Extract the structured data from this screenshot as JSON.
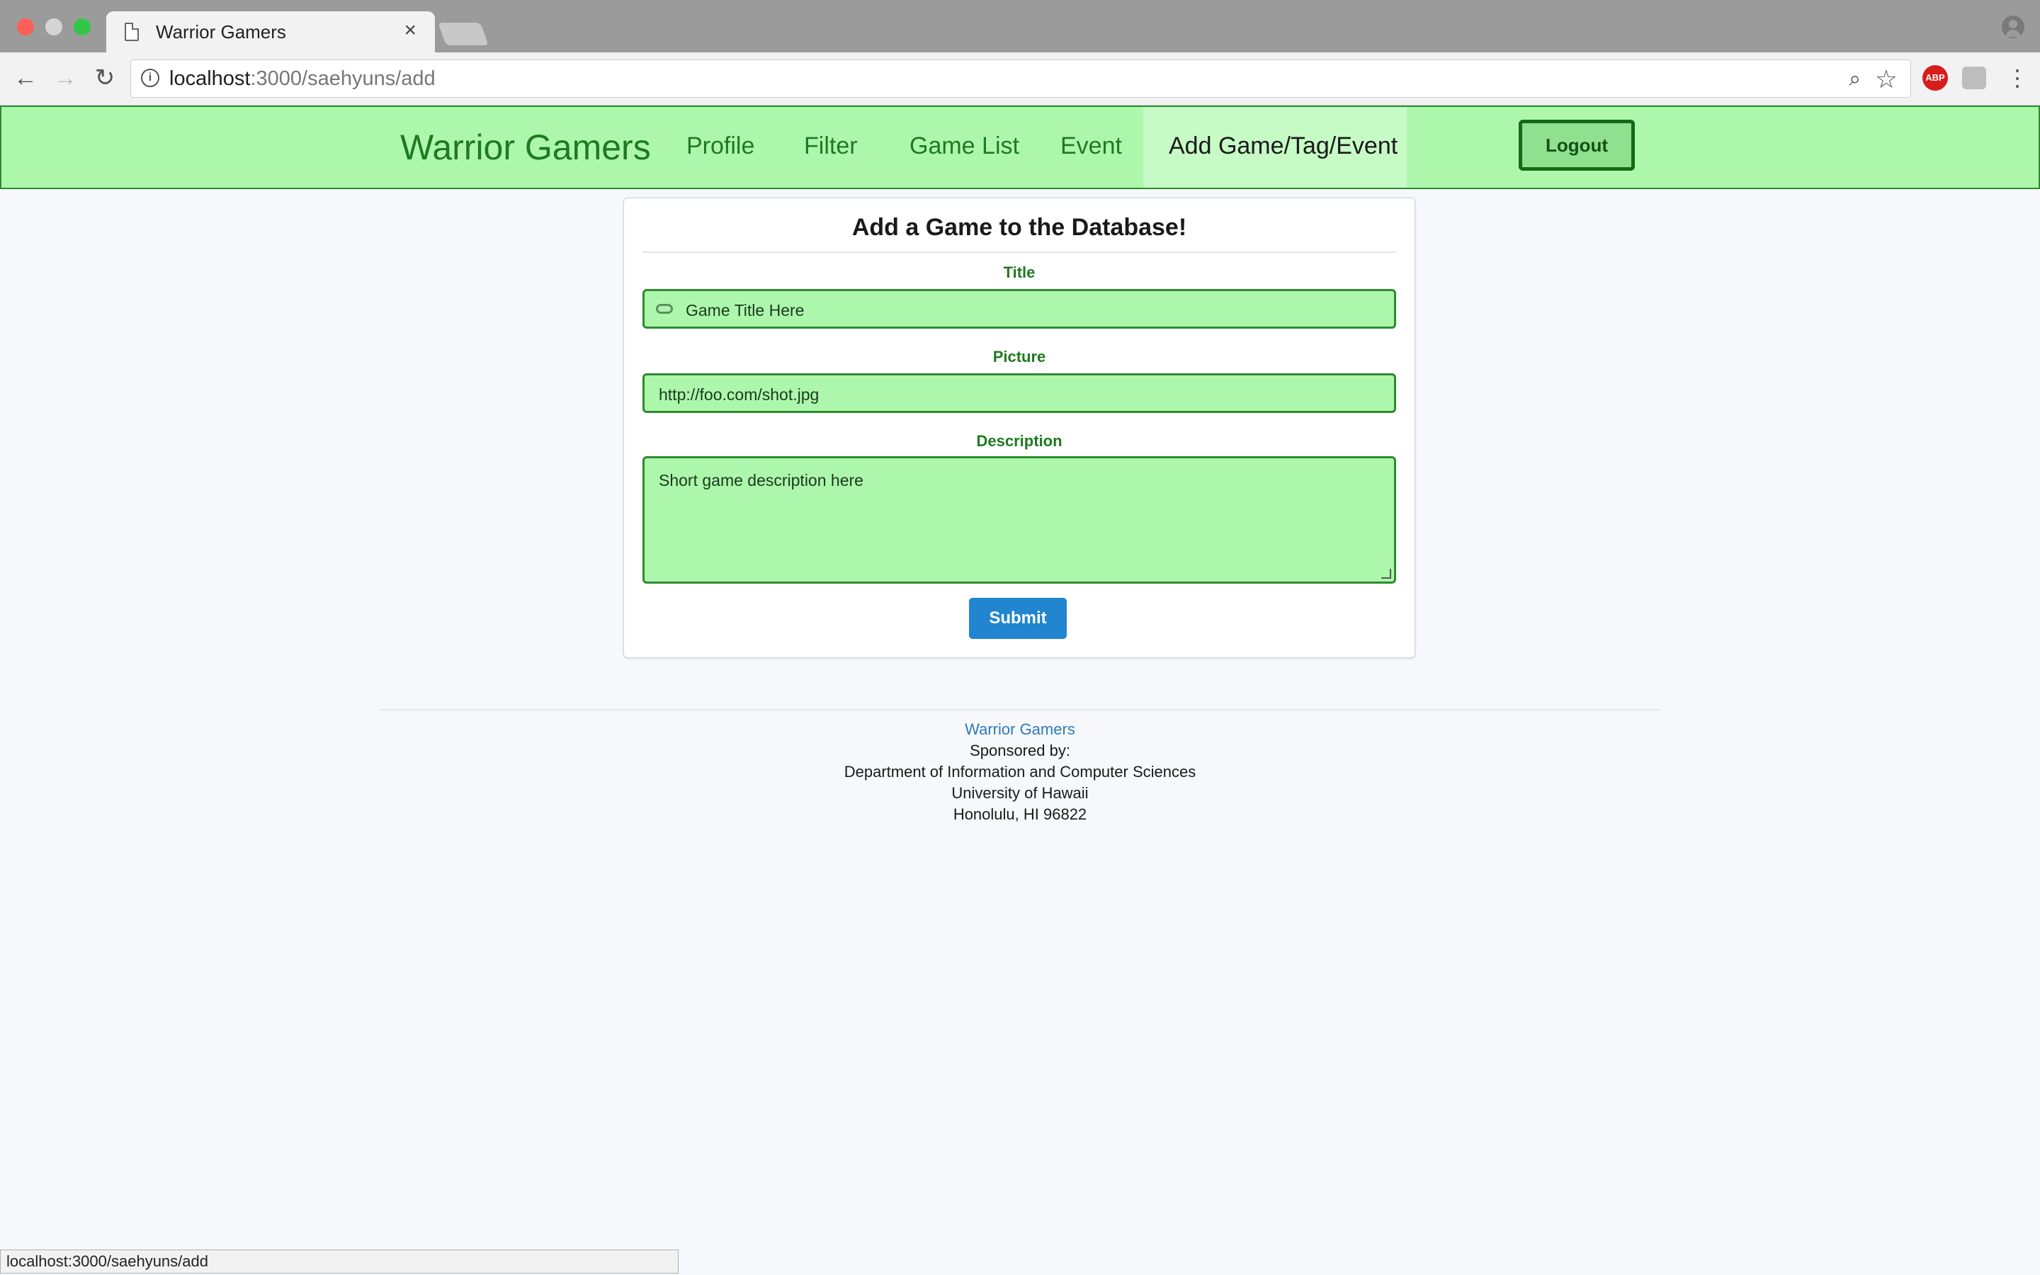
{
  "browser": {
    "tab_title": "Warrior Gamers",
    "tab_close": "×",
    "url_host": "localhost",
    "url_rest": ":3000/saehyuns/add",
    "status_url": "localhost:3000/saehyuns/add",
    "extension_abp": "ABP",
    "icons": [
      "page-icon",
      "back-icon",
      "forward-icon",
      "reload-icon",
      "info-icon",
      "zoom-icon",
      "star-icon",
      "adblock-icon",
      "extension-icon",
      "menu-icon",
      "profile-icon"
    ]
  },
  "nav": {
    "brand": "Warrior Gamers",
    "items": [
      "Profile",
      "Filter",
      "Game List",
      "Event"
    ],
    "active": "Add Game/Tag/Event",
    "logout": "Logout"
  },
  "form": {
    "heading": "Add a Game to the Database!",
    "title_label": "Title",
    "title_placeholder": "Game Title Here",
    "picture_label": "Picture",
    "picture_placeholder": "http://foo.com/shot.jpg",
    "description_label": "Description",
    "description_placeholder": "Short game description here",
    "submit": "Submit"
  },
  "footer": {
    "brand": "Warrior Gamers",
    "lines": [
      "Sponsored by:",
      "Department of Information and Computer Sciences",
      "University of Hawaii",
      "Honolulu, HI 96822"
    ]
  },
  "colors": {
    "nav_bg": "#adf7ad",
    "nav_border": "#2e8b2e",
    "brand_green": "#1f7a1f",
    "submit_blue": "#2185d0"
  }
}
